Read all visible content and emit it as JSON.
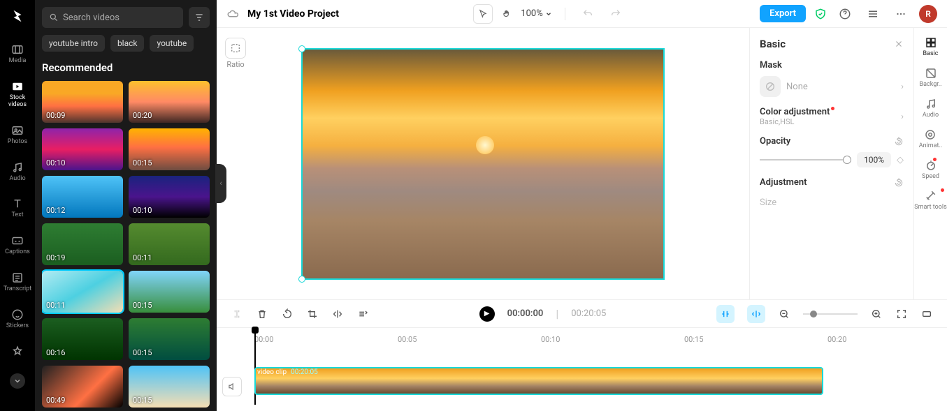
{
  "rail": {
    "media": "Media",
    "stock": "Stock videos",
    "photos": "Photos",
    "audio": "Audio",
    "text": "Text",
    "captions": "Captions",
    "transcript": "Transcript",
    "stickers": "Stickers"
  },
  "search": {
    "placeholder": "Search videos"
  },
  "chips": {
    "a": "youtube intro",
    "b": "black",
    "c": "youtube"
  },
  "section": {
    "title": "Recommended"
  },
  "thumbs": {
    "d0": "00:09",
    "d1": "00:20",
    "d2": "00:10",
    "d3": "00:15",
    "d4": "00:12",
    "d5": "00:10",
    "d6": "00:19",
    "d7": "00:11",
    "d8": "00:11",
    "d9": "00:15",
    "d10": "00:16",
    "d11": "00:15",
    "d12": "00:49",
    "d13": "00:15"
  },
  "project": {
    "title": "My 1st Video Project"
  },
  "topbar": {
    "zoom": "100%",
    "export": "Export",
    "avatar": "R"
  },
  "ratio": {
    "label": "Ratio"
  },
  "panel": {
    "title": "Basic",
    "mask": "Mask",
    "mask_none": "None",
    "color": "Color adjustment",
    "color_sub": "Basic,HSL",
    "opacity": "Opacity",
    "opacity_val": "100%",
    "adjustment": "Adjustment",
    "size": "Size"
  },
  "proprail": {
    "basic": "Basic",
    "bg": "Backgr..",
    "audio": "Audio",
    "anim": "Animat..",
    "speed": "Speed",
    "smart": "Smart tools"
  },
  "player": {
    "cur": "00:00:00",
    "sep": "|",
    "tot": "00:20:05"
  },
  "ruler": {
    "t0": "00:00",
    "t1": "00:05",
    "t2": "00:10",
    "t3": "00:15",
    "t4": "00:20"
  },
  "clip": {
    "name": "video clip",
    "dur": "00:20:05"
  }
}
